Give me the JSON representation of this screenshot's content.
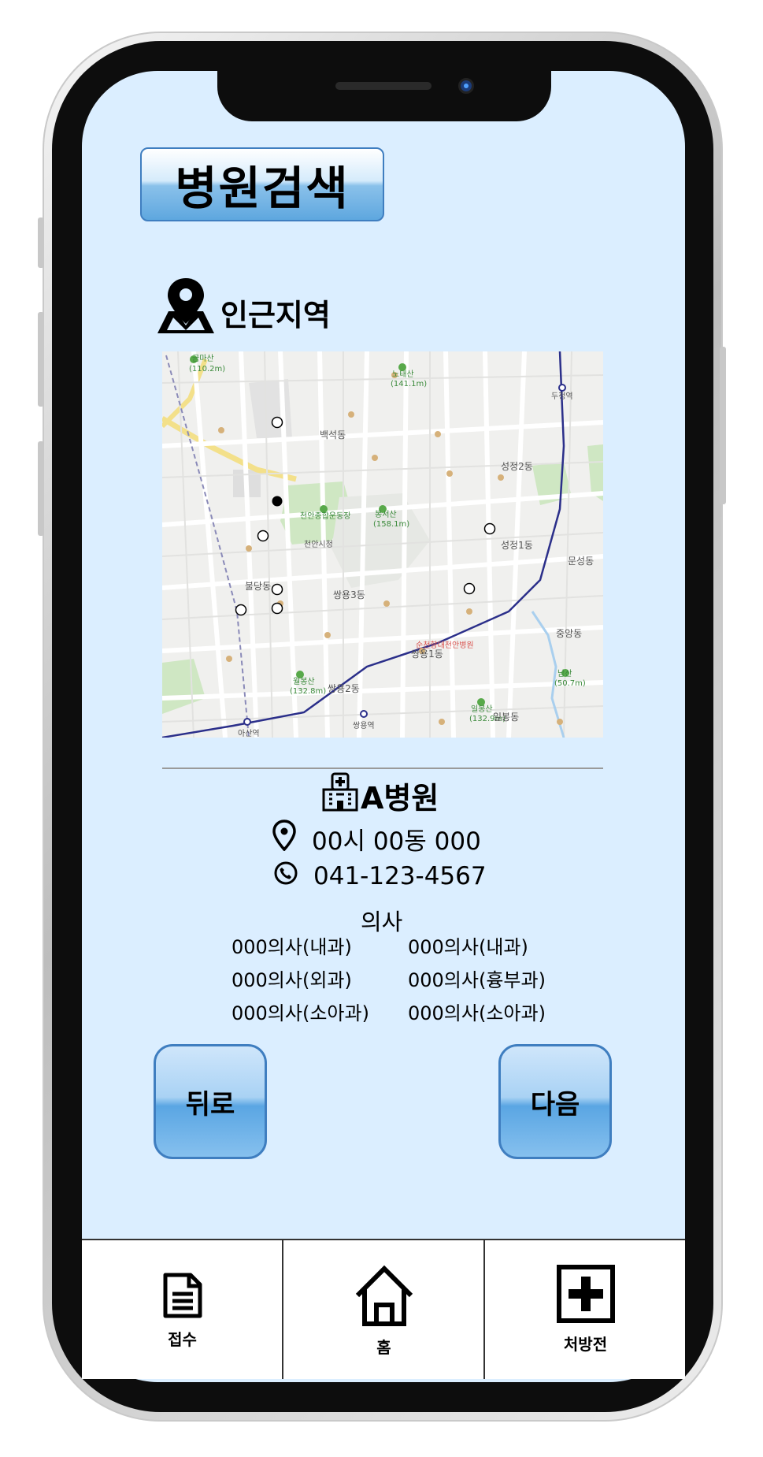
{
  "header": {
    "title": "병원검색"
  },
  "nearby": {
    "label": "인근지역",
    "icon": "map-pin-icon"
  },
  "map": {
    "labels": [
      {
        "text": "금마산",
        "sub": "(110.2m)"
      },
      {
        "text": "노태산",
        "sub": "(141.1m)"
      },
      {
        "text": "봉서산",
        "sub": "(158.1m)"
      },
      {
        "text": "일봉산",
        "sub": "(132.9m)"
      },
      {
        "text": "월봉산",
        "sub": "(132.8m)"
      },
      {
        "text": "남산",
        "sub": "(50.7m)"
      },
      {
        "text": "천안종합운동장"
      },
      {
        "text": "천안시청"
      },
      {
        "text": "성정2동"
      },
      {
        "text": "성정1동"
      },
      {
        "text": "쌍용3동"
      },
      {
        "text": "쌍용2동"
      },
      {
        "text": "쌍용1동"
      },
      {
        "text": "불당동"
      },
      {
        "text": "백석동"
      },
      {
        "text": "문성동"
      },
      {
        "text": "중앙동"
      },
      {
        "text": "일봉동"
      },
      {
        "text": "두정역"
      },
      {
        "text": "아산역"
      },
      {
        "text": "쌍용역"
      },
      {
        "text": "순천향대천안병원"
      }
    ]
  },
  "hospital": {
    "name": "A병원",
    "address": "00시 00동 000",
    "phone": "041-123-4567",
    "doctors_title": "의사",
    "doctors": [
      "000의사(내과)",
      "000의사(내과)",
      "000의사(외과)",
      "000의사(흉부과)",
      "000의사(소아과)",
      "000의사(소아과)"
    ]
  },
  "buttons": {
    "back": "뒤로",
    "next": "다음"
  },
  "tabbar": {
    "items": [
      {
        "label": "접수",
        "icon": "document-icon"
      },
      {
        "label": "홈",
        "icon": "home-icon"
      },
      {
        "label": "처방전",
        "icon": "medical-cross-icon"
      }
    ]
  },
  "colors": {
    "screen_bg": "#dbeeff",
    "button_blue": "#5ea7df",
    "route_line": "#2b2f8a"
  }
}
